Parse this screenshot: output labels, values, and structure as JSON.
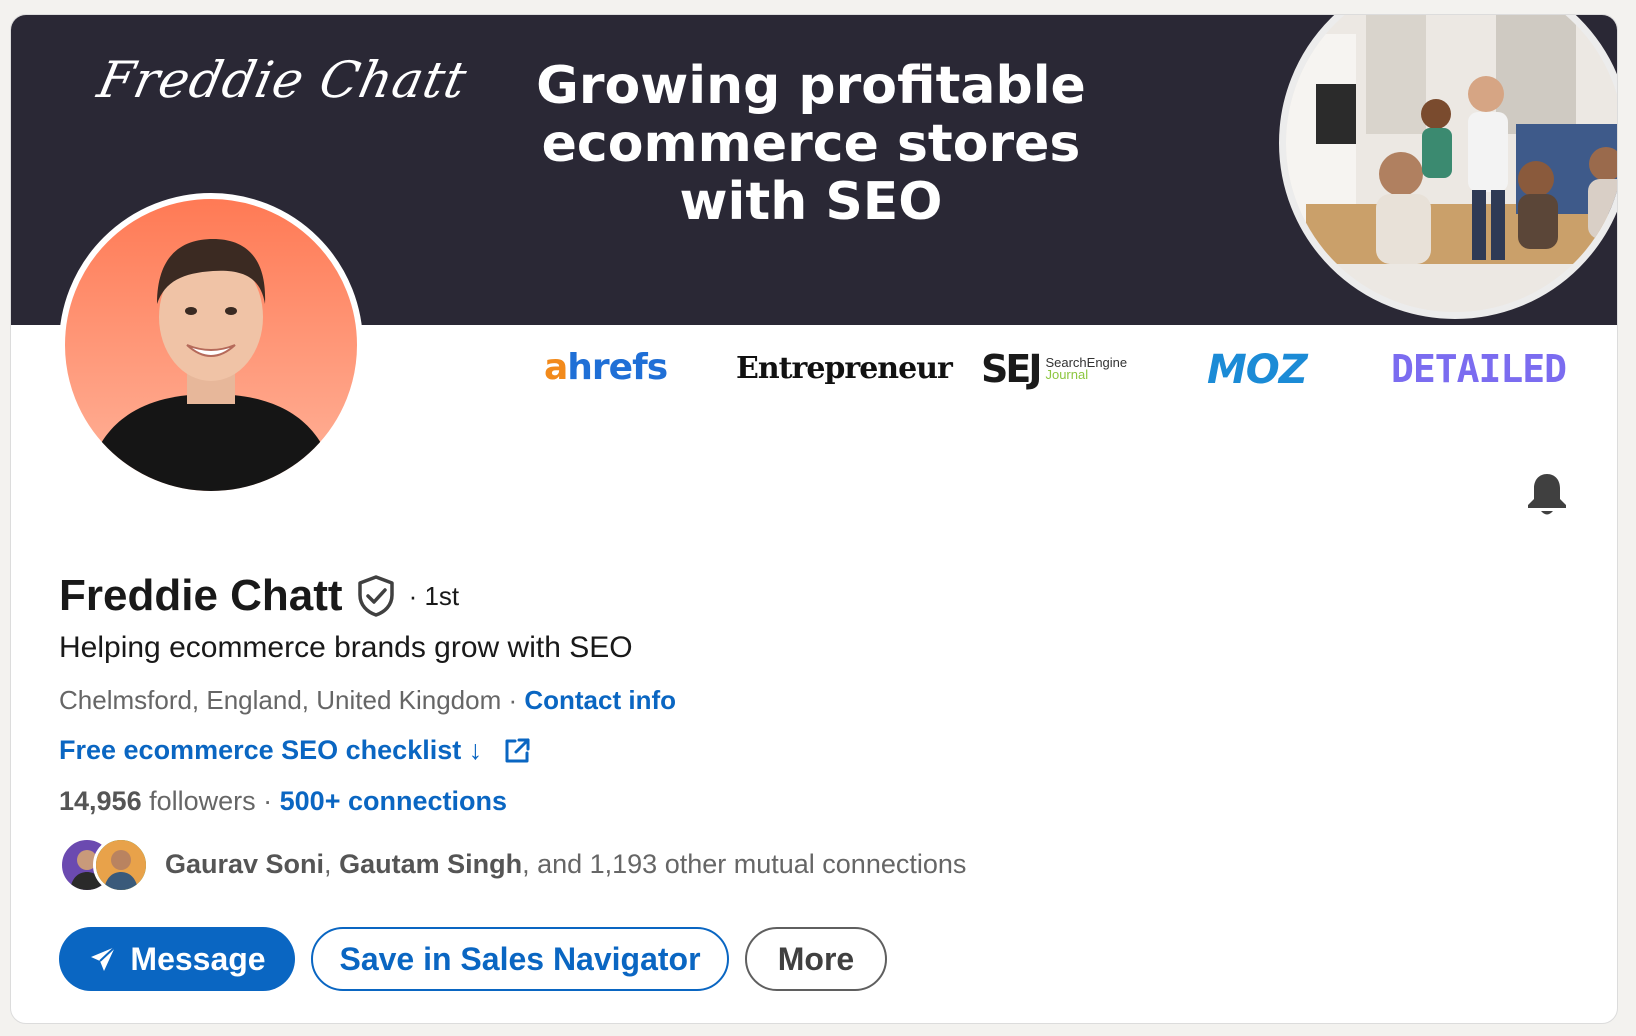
{
  "banner": {
    "signature": "Freddie Chatt",
    "headline_lines": [
      "Growing profitable",
      "ecommerce stores",
      "with SEO"
    ]
  },
  "logos": {
    "ahrefs_a": "a",
    "ahrefs_rest": "hrefs",
    "entrepreneur": "Entrepreneur",
    "sej_big": "SEJ",
    "sej_small_1": "SearchEngine",
    "sej_small_2": "Journal",
    "moz": "MOZ",
    "detailed": "DETAILED"
  },
  "profile": {
    "name": "Freddie Chatt",
    "degree": "· 1st",
    "headline": "Helping ecommerce brands grow with SEO",
    "location": "Chelmsford, England, United Kingdom",
    "location_sep": " · ",
    "contact_info": "Contact info",
    "website_label": "Free ecommerce SEO checklist ↓",
    "followers_count": "14,956",
    "followers_label": " followers",
    "connections_sep": " · ",
    "connections": "500+ connections",
    "mutual_name_1": "Gaurav Soni",
    "mutual_sep": ", ",
    "mutual_name_2": "Gautam Singh",
    "mutual_rest": ", and 1,193 other mutual connections"
  },
  "actions": {
    "message": "Message",
    "save_sales_navigator": "Save in Sales Navigator",
    "more": "More"
  },
  "colors": {
    "accent": "#0a66c2",
    "banner_bg": "#2a2835"
  },
  "icons": {
    "verified": "shield-check-icon",
    "bell": "bell-icon",
    "external_link": "external-link-icon",
    "send": "paper-plane-icon"
  }
}
